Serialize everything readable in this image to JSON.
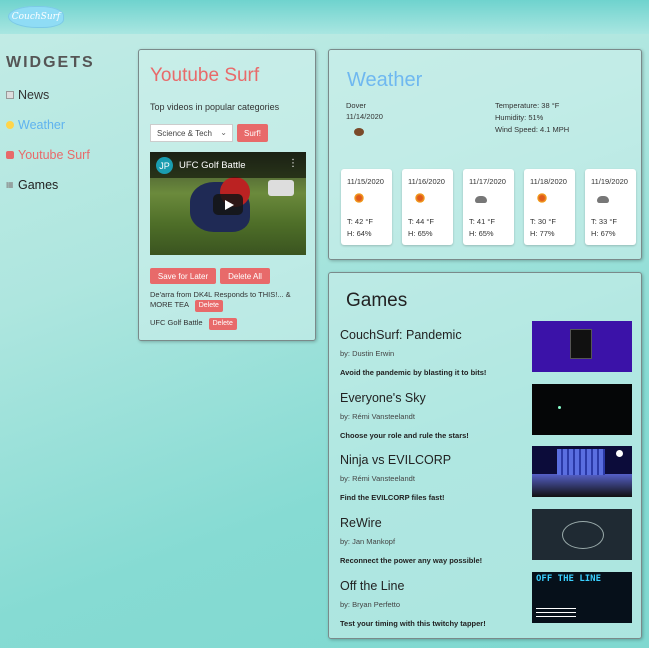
{
  "header": {
    "logo_text": "CouchSurf"
  },
  "sidebar": {
    "title": "WIDGETS",
    "items": [
      {
        "label": "News",
        "color": "#333333",
        "icon": "news-icon"
      },
      {
        "label": "Weather",
        "color": "#5fb3ef",
        "icon": "sun-icon"
      },
      {
        "label": "Youtube Surf",
        "color": "#e86a6a",
        "icon": "youtube-icon"
      },
      {
        "label": "Games",
        "color": "#222222",
        "icon": "gamepad-icon"
      }
    ]
  },
  "youtube": {
    "title": "Youtube Surf",
    "subtitle": "Top videos in popular categories",
    "category_selected": "Science & Tech",
    "surf_label": "Surf!",
    "video_title": "UFC Golf Battle",
    "channel_initial": "JP",
    "save_label": "Save for Later",
    "delete_all_label": "Delete All",
    "saved": [
      {
        "title": "De'arra from DK4L Responds to THIS!... & MORE TEA",
        "delete_label": "Delete"
      },
      {
        "title": "UFC Golf Battle",
        "delete_label": "Delete"
      }
    ]
  },
  "weather": {
    "title": "Weather",
    "city": "Dover",
    "date": "11/14/2020",
    "temperature": "Temperature: 38 °F",
    "humidity": "Humidity: 51%",
    "wind": "Wind Speed: 4.1 MPH",
    "forecast": [
      {
        "date": "11/15/2020",
        "icon": "sun-icon",
        "temp": "T: 42 °F",
        "hum": "H: 64%"
      },
      {
        "date": "11/16/2020",
        "icon": "sun-icon",
        "temp": "T: 44 °F",
        "hum": "H: 65%"
      },
      {
        "date": "11/17/2020",
        "icon": "cloud-icon",
        "temp": "T: 41 °F",
        "hum": "H: 65%"
      },
      {
        "date": "11/18/2020",
        "icon": "sun-icon",
        "temp": "T: 30 °F",
        "hum": "H: 77%"
      },
      {
        "date": "11/19/2020",
        "icon": "cloud-icon",
        "temp": "T: 33 °F",
        "hum": "H: 67%"
      }
    ]
  },
  "games": {
    "title": "Games",
    "items": [
      {
        "title": "CouchSurf: Pandemic",
        "author": "by: Dustin Erwin",
        "desc": "Avoid the pandemic by blasting it to bits!"
      },
      {
        "title": "Everyone's Sky",
        "author": "by: Rémi Vansteelandt",
        "desc": "Choose your role and rule the stars!"
      },
      {
        "title": "Ninja vs EVILCORP",
        "author": "by: Rémi Vansteelandt",
        "desc": "Find the EVILCORP files fast!"
      },
      {
        "title": "ReWire",
        "author": "by: Jan Mankopf",
        "desc": "Reconnect the power any way possible!"
      },
      {
        "title": "Off the Line",
        "author": "by: Bryan Perfetto",
        "desc": "Test your timing with this twitchy tapper!"
      }
    ]
  }
}
